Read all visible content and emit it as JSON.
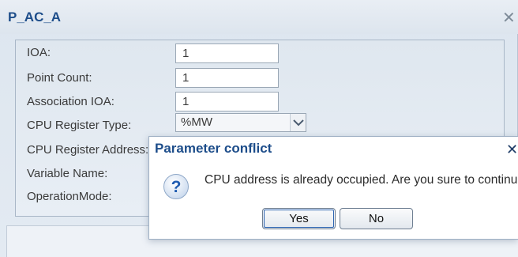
{
  "window": {
    "title": "P_AC_A"
  },
  "form": {
    "ioa_label": "IOA:",
    "ioa_value": "1",
    "point_count_label": "Point Count:",
    "point_count_value": "1",
    "association_ioa_label": "Association IOA:",
    "association_ioa_value": "1",
    "cpu_register_type_label": "CPU Register Type:",
    "cpu_register_type_value": "%MW",
    "cpu_register_address_label": "CPU Register Address:",
    "variable_name_label": "Variable Name:",
    "operation_mode_label": "OperationMode:"
  },
  "dialog": {
    "title": "Parameter conflict",
    "message": "CPU address is already occupied. Are you sure to continue?",
    "yes_label": "Yes",
    "no_label": "No"
  },
  "icons": {
    "close": "close-icon",
    "question": "question-icon",
    "dropdown": "chevron-down-icon"
  },
  "colors": {
    "title_text": "#1d4d8a",
    "window_bg": "#dde6ef",
    "question_icon": "#1e5bb0"
  }
}
